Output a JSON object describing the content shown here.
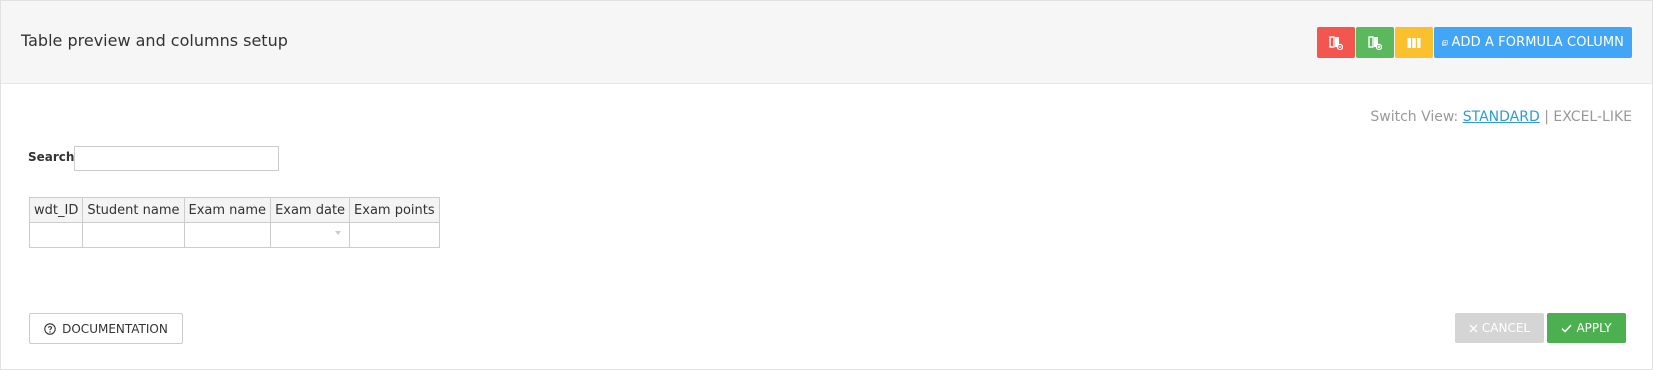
{
  "header": {
    "title": "Table preview and columns setup",
    "buttons": {
      "remove_columns_icon": "column-remove-icon",
      "add_column_icon": "column-add-icon",
      "columns_icon": "columns-icon",
      "add_formula_label": "ADD A FORMULA COLUMN",
      "add_formula_icon": "plus-square-icon"
    }
  },
  "switch_view": {
    "label": "Switch View:",
    "standard": "STANDARD",
    "separator": "|",
    "excel_like": "EXCEL-LIKE"
  },
  "search": {
    "label": "Search:",
    "value": "",
    "placeholder": ""
  },
  "table": {
    "columns": [
      "wdt_ID",
      "Student name",
      "Exam name",
      "Exam date",
      "Exam points"
    ]
  },
  "footer": {
    "documentation_label": "DOCUMENTATION",
    "cancel_label": "CANCEL",
    "apply_label": "APPLY"
  },
  "colors": {
    "red": "#f2564e",
    "green": "#5cb85c",
    "yellow": "#fbc02d",
    "blue": "#42a5f5",
    "apply": "#4caf50",
    "cancel": "#d5d5d5",
    "link": "#2d9cdb"
  }
}
